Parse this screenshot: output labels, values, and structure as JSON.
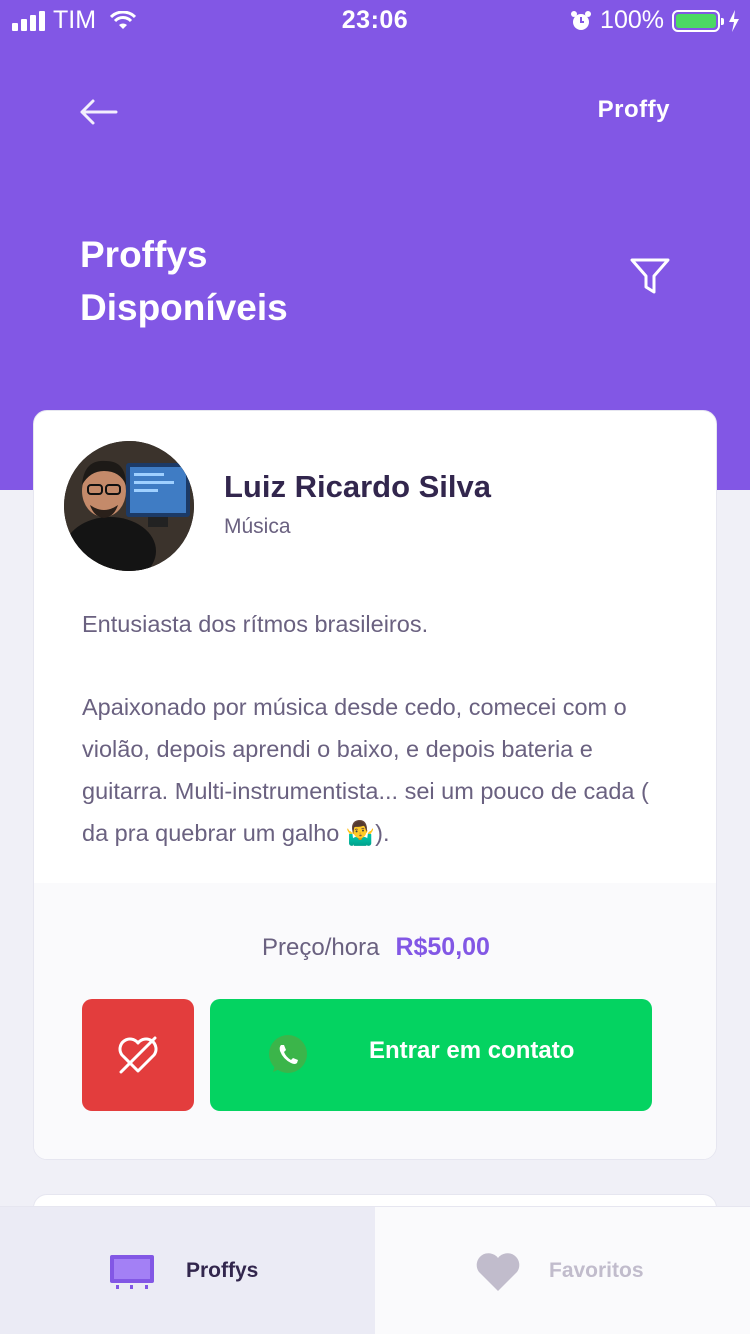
{
  "status_bar": {
    "carrier": "TIM",
    "time": "23:06",
    "battery": "100%"
  },
  "header": {
    "logo": "Proffy",
    "title_line1": "Proffys",
    "title_line2": "Disponíveis",
    "back_icon": "arrow-left-icon",
    "filter_icon": "filter-icon"
  },
  "teacher_card": {
    "name": "Luiz Ricardo Silva",
    "subject": "Música",
    "bio_paragraph_1": "Entusiasta dos rítmos brasileiros.",
    "bio_paragraph_2": "Apaixonado por música desde cedo, comecei com o violão, depois aprendi o baixo, e depois bateria e guitarra. Multi-instrumentista... sei um pouco de cada ( da pra quebrar um galho 🤷‍♂️).",
    "price_label": "Preço/hora",
    "price_value": "R$50,00",
    "contact_label": "Entrar em contato",
    "colors": {
      "accent": "#8257E5",
      "unfavorite": "#E33D3D",
      "contact": "#04D361"
    }
  },
  "tabbar": {
    "tabs": [
      {
        "label": "Proffys",
        "icon": "easel-icon",
        "active": true
      },
      {
        "label": "Favoritos",
        "icon": "heart-icon",
        "active": false
      }
    ]
  }
}
